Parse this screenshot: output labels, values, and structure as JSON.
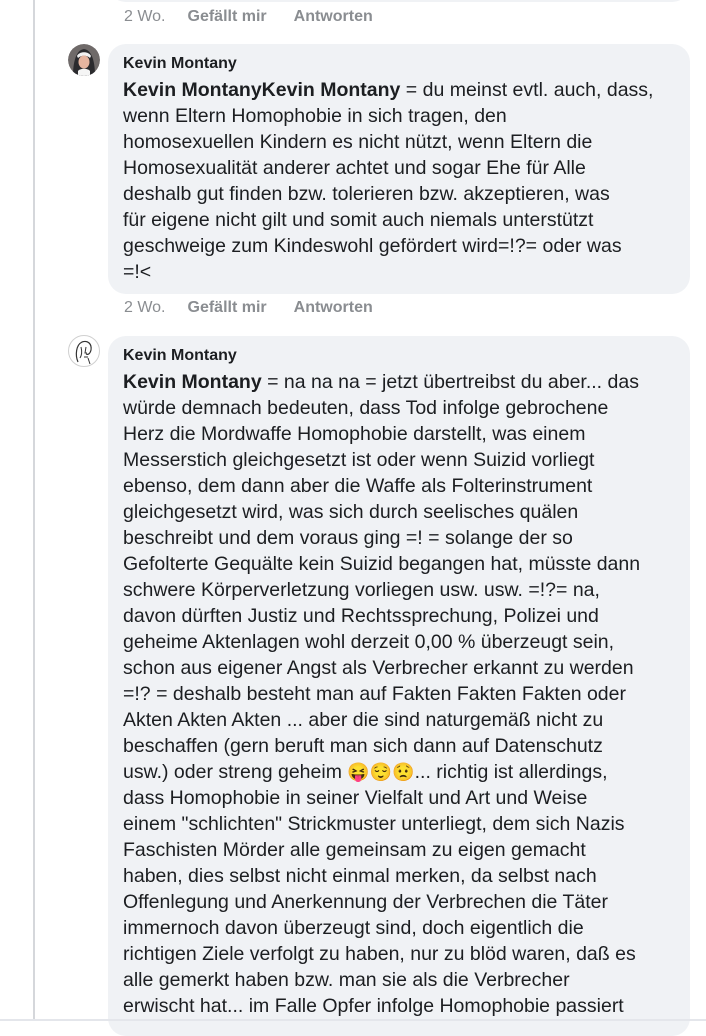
{
  "comments": [
    {
      "time": "2 Wo.",
      "like_label": "Gefällt mir",
      "reply_label": "Antworten"
    },
    {
      "author": "Kevin Montany",
      "mention": "Kevin MontanyKevin Montany",
      "text": " = du meinst evtl. auch, dass,\nwenn Eltern Homophobie in sich tragen, den\nhomosexuellen Kindern es nicht  nützt, wenn Eltern die\nHomosexualität anderer achtet und sogar Ehe für Alle\ndeshalb gut finden bzw. tolerieren bzw. akzeptieren, was\nfür eigene nicht gilt und somit auch niemals unterstützt\ngeschweige zum Kindeswohl gefördert wird=!?= oder was\n=!<",
      "time": "2 Wo.",
      "like_label": "Gefällt mir",
      "reply_label": "Antworten"
    },
    {
      "author": "Kevin Montany",
      "mention": "Kevin Montany",
      "text_before_emoji": " = na na na = jetzt übertreibst du aber... das\nwürde demnach bedeuten, dass Tod infolge gebrochene\nHerz die Mordwaffe Homophobie darstellt, was einem\nMesserstich gleichgesetzt ist oder wenn Suizid vorliegt\nebenso, dem dann aber die Waffe als Folterinstrument\ngleichgesetzt wird, was sich durch  seelisches quälen\nbeschreibt und dem voraus ging =! = solange der so\nGefolterte Gequälte kein Suizid begangen hat, müsste dann\nschwere Körperverletzung vorliegen usw. usw. =!?= na,\ndavon dürften Justiz und Rechtssprechung, Polizei und\ngeheime Aktenlagen wohl derzeit 0,00 % überzeugt sein,\nschon aus eigener Angst als Verbrecher erkannt zu werden\n=!? = deshalb besteht man auf  Fakten Fakten Fakten oder\nAkten Akten Akten ... aber die sind naturgemäß nicht zu\nbeschaffen (gern beruft man sich dann auf Datenschutz\nusw.) oder streng geheim ",
      "emojis": "😝😌😟",
      "text_after_emoji": "... richtig ist allerdings,\ndass Homophobie in seiner Vielfalt und Art und Weise\neinem \"schlichten\" Strickmuster unterliegt, dem sich Nazis\nFaschisten Mörder alle gemeinsam zu eigen gemacht\nhaben, dies selbst nicht einmal merken, da selbst nach\nOffenlegung und Anerkennung der Verbrechen die Täter\nimmernoch davon überzeugt sind, doch eigentlich die\nrichtigen Ziele verfolgt zu haben, nur zu blöd waren, daß es\nalle gemerkt haben bzw. man sie als  die Verbrecher\nerwischt hat... im Falle Opfer infolge Homophobie passiert"
    }
  ]
}
